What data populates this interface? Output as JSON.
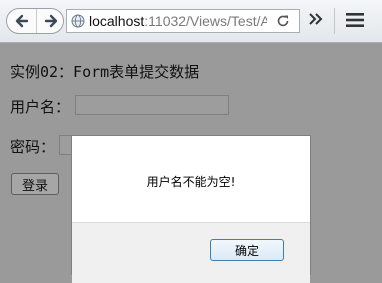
{
  "browser": {
    "url_host": "localhost",
    "url_rest": ":11032/Views/Test/A",
    "back_icon": "arrow-left",
    "forward_icon": "arrow-right",
    "reload_icon": "reload",
    "overflow_icon": "double-chevron",
    "menu_icon": "hamburger"
  },
  "page": {
    "heading": "实例02：Form表单提交数据",
    "username_label": "用户名：",
    "password_label": "密码：",
    "login_button": "登录"
  },
  "dialog": {
    "message": "用户名不能为空!",
    "ok_button": "确定"
  }
}
